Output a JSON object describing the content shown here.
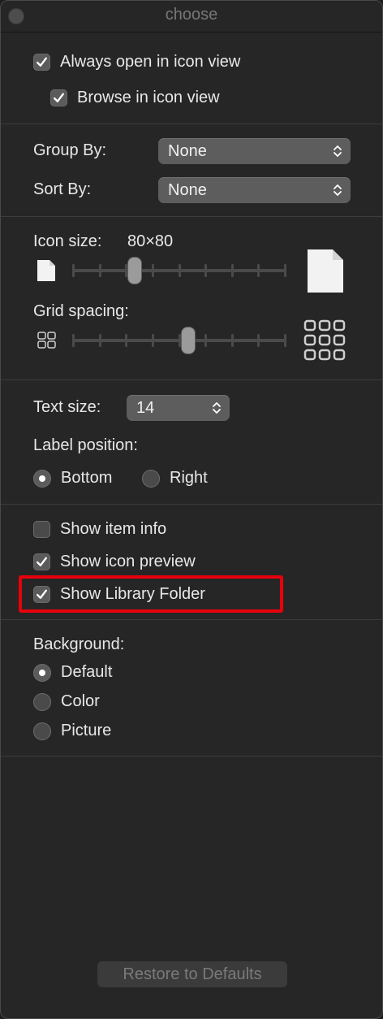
{
  "window": {
    "title": "choose"
  },
  "view": {
    "always_open_icon_view": {
      "label": "Always open in icon view",
      "checked": true
    },
    "browse_icon_view": {
      "label": "Browse in icon view",
      "checked": true
    }
  },
  "arrange": {
    "group_by": {
      "label": "Group By:",
      "value": "None"
    },
    "sort_by": {
      "label": "Sort By:",
      "value": "None"
    }
  },
  "icon": {
    "size_label": "Icon size:",
    "size_value": "80×80",
    "size_slider_level": 0.29,
    "grid_label": "Grid spacing:",
    "grid_slider_level": 0.54
  },
  "text": {
    "size_label": "Text size:",
    "size_value": "14",
    "label_position_label": "Label position:",
    "options": [
      "Bottom",
      "Right"
    ],
    "selected": "Bottom"
  },
  "show": {
    "item_info": {
      "label": "Show item info",
      "checked": false
    },
    "icon_preview": {
      "label": "Show icon preview",
      "checked": true
    },
    "library_folder": {
      "label": "Show Library Folder",
      "checked": true
    }
  },
  "background": {
    "label": "Background:",
    "options": [
      "Default",
      "Color",
      "Picture"
    ],
    "selected": "Default"
  },
  "footer": {
    "restore_label": "Restore to Defaults"
  },
  "colors": {
    "highlight": "#e8000b",
    "panel": "#262626"
  }
}
